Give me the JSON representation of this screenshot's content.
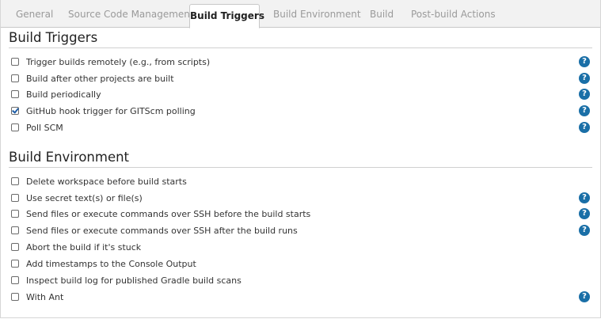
{
  "tabs": [
    {
      "label": "General"
    },
    {
      "label": "Source Code Management"
    },
    {
      "label": "Build Triggers",
      "active": true
    },
    {
      "label": "Build Environment"
    },
    {
      "label": "Build"
    },
    {
      "label": "Post-build Actions"
    }
  ],
  "help_glyph": "?",
  "build_triggers": {
    "title": "Build Triggers",
    "options": [
      {
        "label": "Trigger builds remotely (e.g., from scripts)",
        "checked": false,
        "has_help": true
      },
      {
        "label": "Build after other projects are built",
        "checked": false,
        "has_help": true
      },
      {
        "label": "Build periodically",
        "checked": false,
        "has_help": true
      },
      {
        "label": "GitHub hook trigger for GITScm polling",
        "checked": true,
        "has_help": true
      },
      {
        "label": "Poll SCM",
        "checked": false,
        "has_help": true
      }
    ]
  },
  "build_environment": {
    "title": "Build Environment",
    "options": [
      {
        "label": "Delete workspace before build starts",
        "checked": false,
        "has_help": false
      },
      {
        "label": "Use secret text(s) or file(s)",
        "checked": false,
        "has_help": true
      },
      {
        "label": "Send files or execute commands over SSH before the build starts",
        "checked": false,
        "has_help": true
      },
      {
        "label": "Send files or execute commands over SSH after the build runs",
        "checked": false,
        "has_help": true
      },
      {
        "label": "Abort the build if it's stuck",
        "checked": false,
        "has_help": false
      },
      {
        "label": "Add timestamps to the Console Output",
        "checked": false,
        "has_help": false
      },
      {
        "label": "Inspect build log for published Gradle build scans",
        "checked": false,
        "has_help": false
      },
      {
        "label": "With Ant",
        "checked": false,
        "has_help": true
      }
    ]
  },
  "colors": {
    "accent": "#1a6fa7",
    "tabbar_bg": "#f2f2f2",
    "inactive_tab_text": "#9a9a9a"
  }
}
